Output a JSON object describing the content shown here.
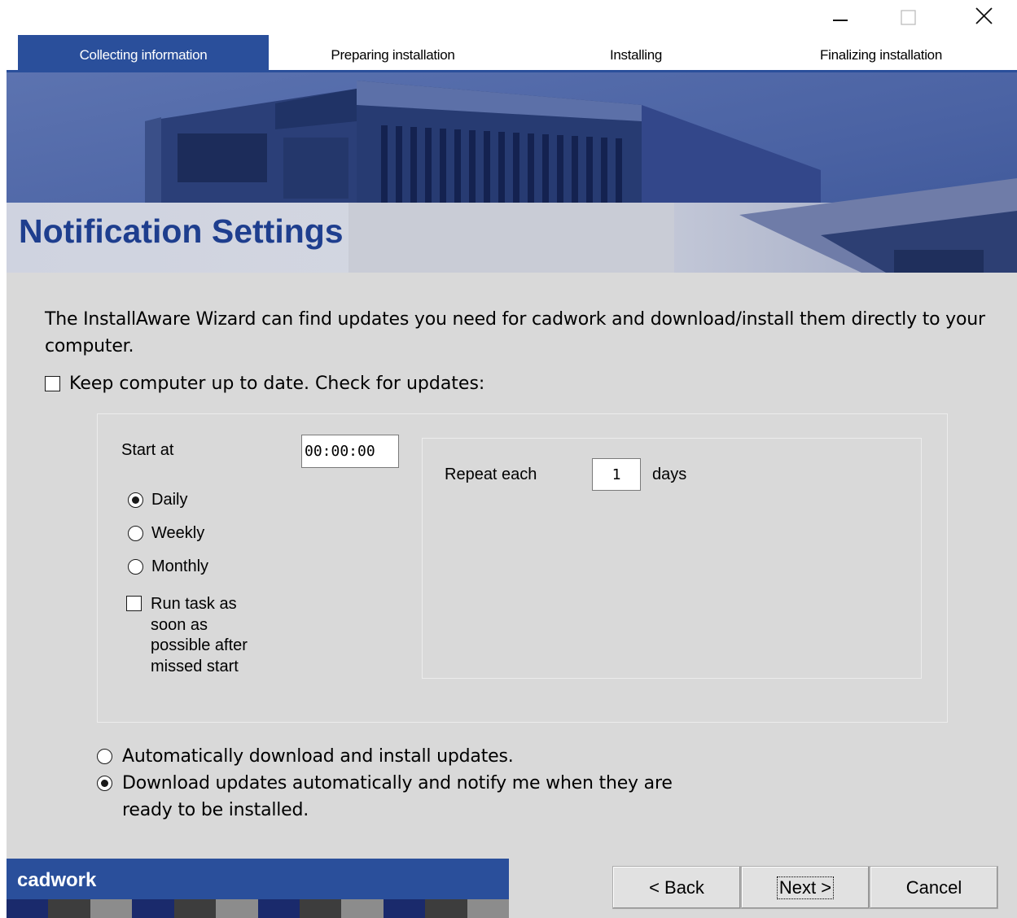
{
  "window": {
    "minimize_icon": "minimize-icon",
    "maximize_icon": "maximize-icon",
    "close_icon": "close-icon"
  },
  "steps": [
    {
      "label": "Collecting information",
      "active": true
    },
    {
      "label": "Preparing installation",
      "active": false
    },
    {
      "label": "Installing",
      "active": false
    },
    {
      "label": "Finalizing installation",
      "active": false
    }
  ],
  "page": {
    "title": "Notification Settings",
    "description": "The InstallAware Wizard can find updates you need for cadwork and download/install them directly to your computer."
  },
  "updates": {
    "keep_updated_label": "Keep computer up to date. Check for updates:",
    "keep_updated_checked": false,
    "start_at_label": "Start at",
    "start_at_value": "00:00:00",
    "frequency": [
      {
        "label": "Daily",
        "selected": true
      },
      {
        "label": "Weekly",
        "selected": false
      },
      {
        "label": "Monthly",
        "selected": false
      }
    ],
    "run_missed_label": "Run task as soon as possible after missed start",
    "run_missed_checked": false,
    "repeat_label": "Repeat each",
    "repeat_value": "1",
    "repeat_unit": "days"
  },
  "mode_options": [
    {
      "label": "Automatically download and install updates.",
      "selected": false
    },
    {
      "label": "Download updates automatically and notify me when they are ready to be installed.",
      "selected": true
    }
  ],
  "footer": {
    "brand": "cadwork",
    "back_label": "< Back",
    "next_label": "Next >",
    "cancel_label": "Cancel"
  },
  "colors": {
    "accent": "#2a4f9b",
    "title": "#1e3e8e",
    "panel": "#d9d9d9"
  }
}
